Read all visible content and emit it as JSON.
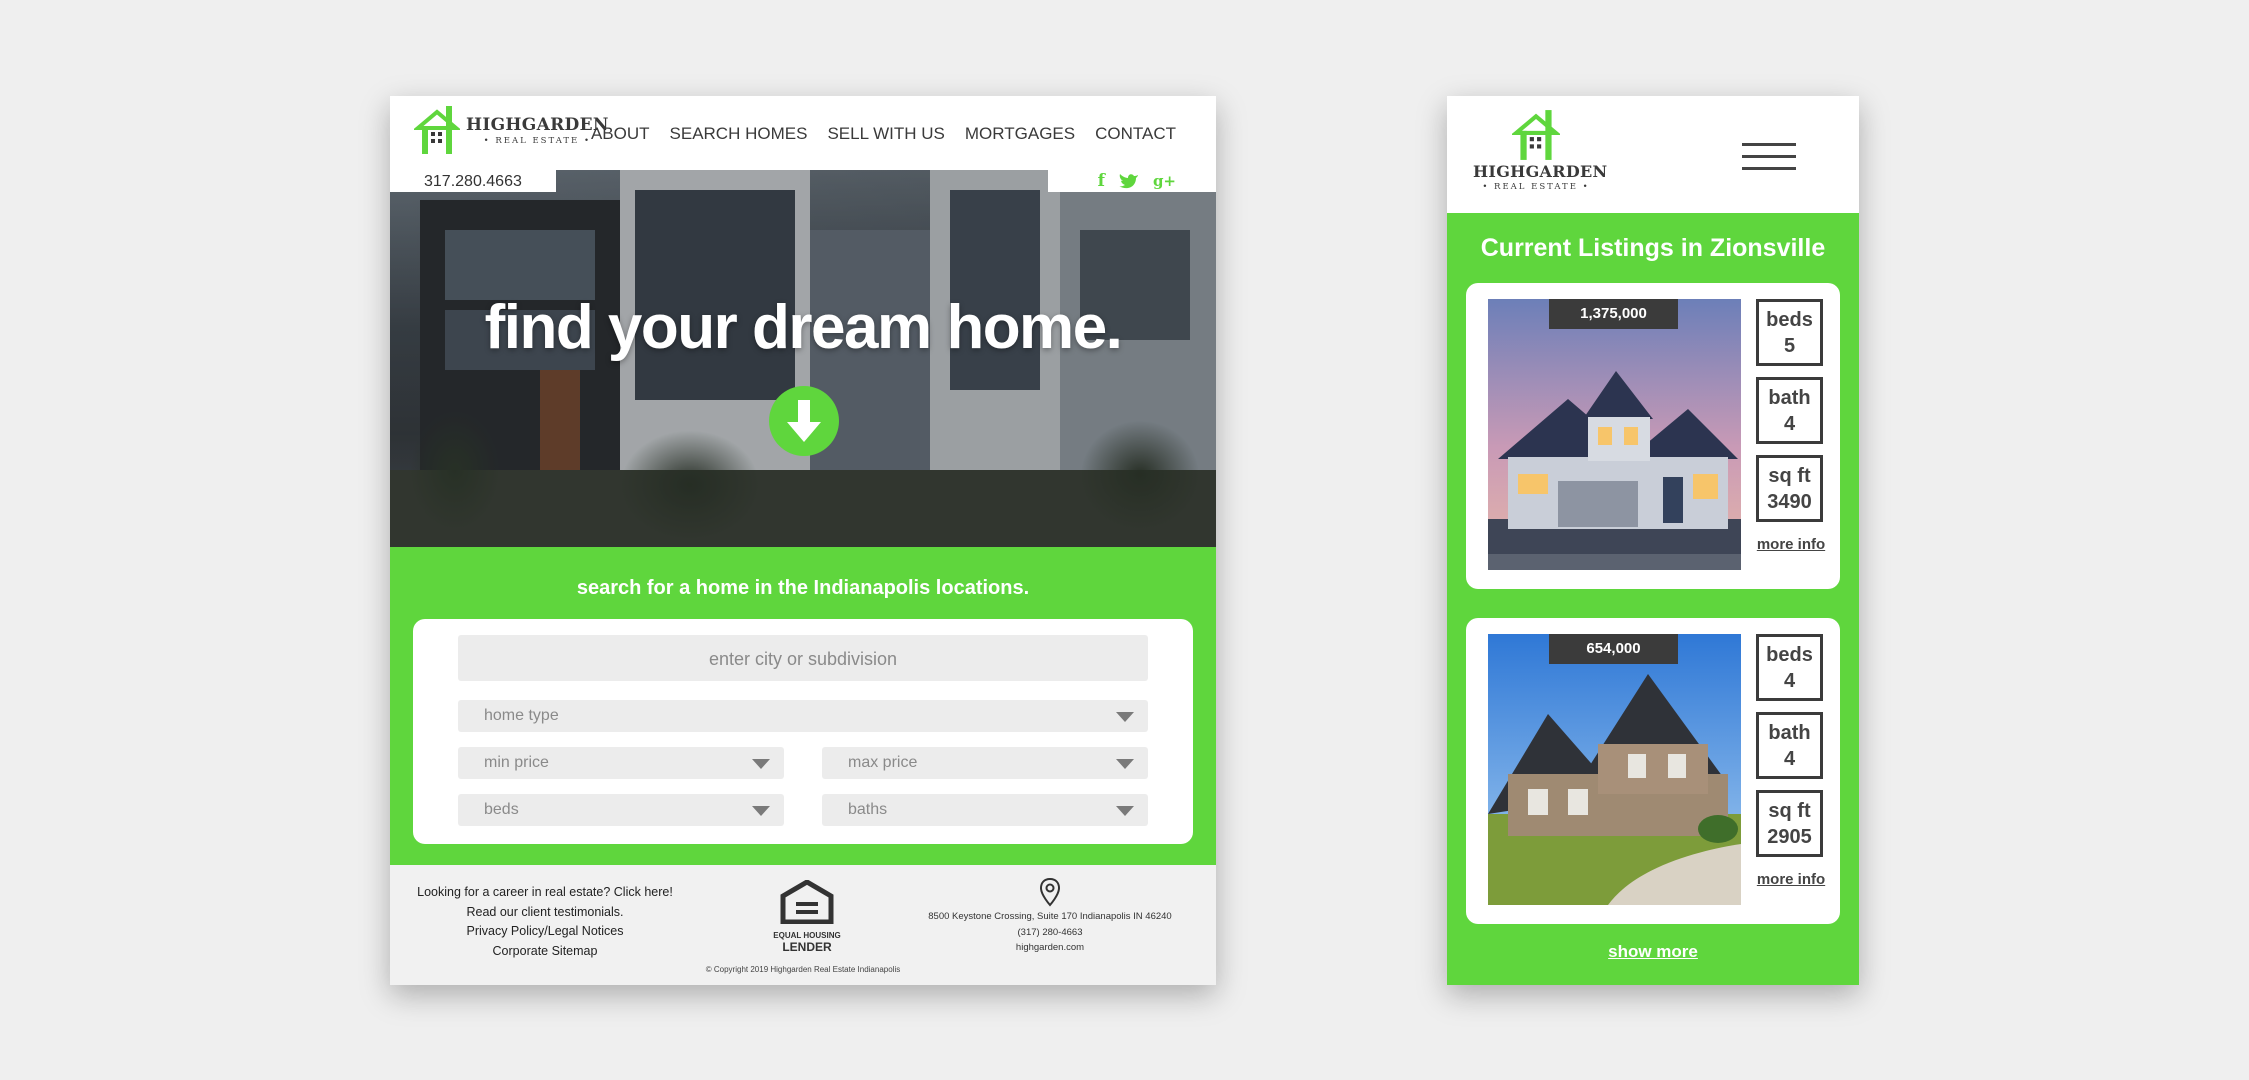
{
  "desktop": {
    "logo": {
      "name": "HIGHGARDEN",
      "sub": "• REAL ESTATE •"
    },
    "nav": [
      "ABOUT",
      "SEARCH HOMES",
      "SELL WITH US",
      "MORTGAGES",
      "CONTACT"
    ],
    "phone": "317.280.4663",
    "social": [
      "f",
      "twitter",
      "g+"
    ],
    "hero": {
      "title": "find your dream home."
    },
    "search": {
      "title": "search for a home in the Indianapolis locations.",
      "city_placeholder": "enter city or subdivision",
      "home_type": "home type",
      "min_price": "min price",
      "max_price": "max price",
      "beds": "beds",
      "baths": "baths"
    },
    "footer": {
      "links": [
        "Looking for a career in real estate? Click here!",
        "Read our client testimonials.",
        "Privacy Policy/Legal Notices",
        "Corporate Sitemap"
      ],
      "ehl_line1": "EQUAL HOUSING",
      "ehl_line2": "LENDER",
      "address": "8500 Keystone Crossing, Suite 170 Indianapolis IN 46240",
      "phone": "(317) 280-4663",
      "website": "highgarden.com",
      "copyright": "© Copyright 2019 Highgarden Real Estate Indianapolis"
    }
  },
  "mobile": {
    "logo": {
      "name": "HIGHGARDEN",
      "sub": "• REAL ESTATE •"
    },
    "title": "Current Listings in Zionsville",
    "listings": [
      {
        "price": "1,375,000",
        "beds_label": "beds",
        "beds": "5",
        "bath_label": "bath",
        "bath": "4",
        "sqft_label": "sq ft",
        "sqft": "3490",
        "more": "more info"
      },
      {
        "price": "654,000",
        "beds_label": "beds",
        "beds": "4",
        "bath_label": "bath",
        "bath": "4",
        "sqft_label": "sq ft",
        "sqft": "2905",
        "more": "more info"
      }
    ],
    "show_more": "show more"
  },
  "colors": {
    "brand_green": "#5fd63d",
    "dark": "#3b3b3b",
    "background": "#efefef"
  },
  "icons": [
    "house-logo-icon",
    "facebook-icon",
    "twitter-icon",
    "google-plus-icon",
    "down-arrow-icon",
    "equal-housing-icon",
    "location-pin-icon",
    "hamburger-menu-icon"
  ]
}
